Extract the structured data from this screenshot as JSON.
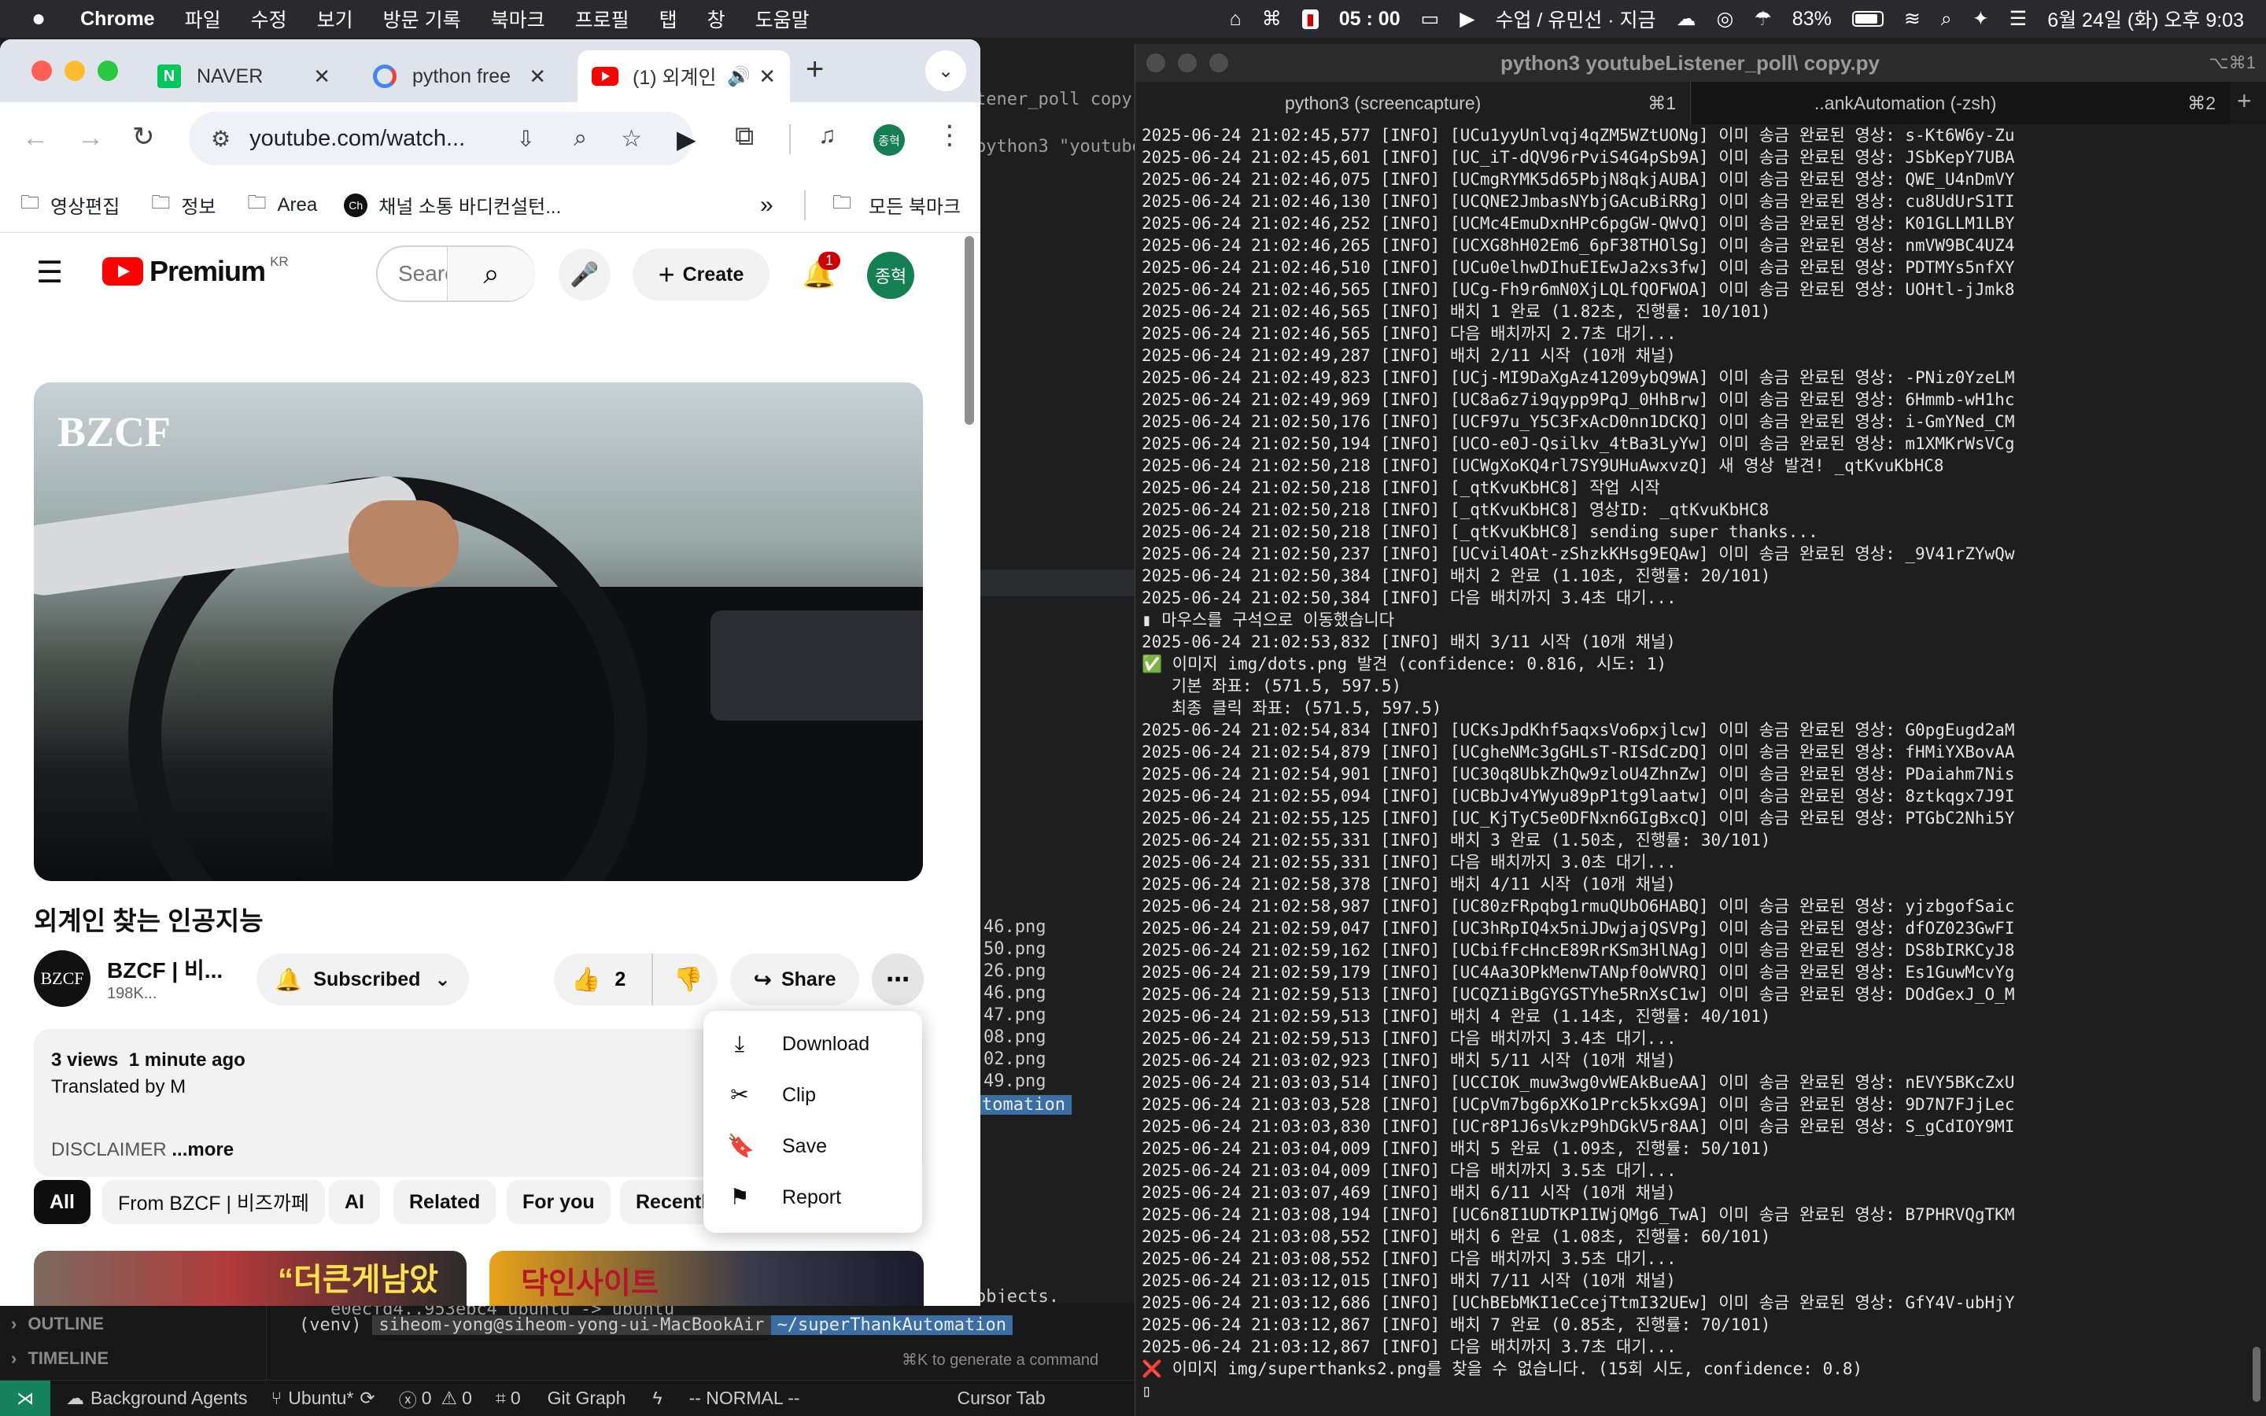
{
  "menubar": {
    "app": "Chrome",
    "items": [
      "파일",
      "수정",
      "보기",
      "방문 기록",
      "북마크",
      "프로필",
      "탭",
      "창",
      "도움말"
    ],
    "time": "05 : 00",
    "now_playing": "수업 / 유민선 · 지금",
    "battery": "83%",
    "datetime": "6월 24일 (화) 오후 9:03"
  },
  "chrome": {
    "tabs": [
      {
        "title": "NAVER",
        "icon": "naver-icon"
      },
      {
        "title": "python free",
        "icon": "google-icon"
      },
      {
        "title": "(1) 외계인",
        "icon": "youtube-icon"
      }
    ],
    "url": "youtube.com/watch...",
    "profile_initial": "종혁",
    "bookmarks": [
      "영상편집",
      "정보",
      "Area",
      "채널 소통 바디컨설턴..."
    ],
    "all_bookmarks": "모든 북마크",
    "chevron": "»"
  },
  "youtube": {
    "logo_text": "Premium",
    "region": "KR",
    "search_placeholder": "Search",
    "create_label": "Create",
    "notifications_count": "1",
    "avatar": "종혁",
    "video_watermark": "BZCF",
    "video_title": "외계인 찾는 인공지능",
    "channel_name": "BZCF | 비...",
    "channel_avatar": "BZCF",
    "subscribers": "198K...",
    "subscribed_label": "Subscribed",
    "likes": "2",
    "share_label": "Share",
    "views": "3 views",
    "published": "1 minute ago",
    "translated": "Translated by M",
    "disclaimer": "DISCLAIMER",
    "more": "...more",
    "chips": [
      "All",
      "From BZCF | 비즈까페",
      "AI",
      "Related",
      "For you",
      "Recently uploaded"
    ],
    "thumb1_text": "“더큰게남았다”",
    "thumb2_text": "닥인사이트"
  },
  "menu": {
    "items": [
      {
        "label": "Download",
        "icon": "download-icon"
      },
      {
        "label": "Clip",
        "icon": "scissors-icon"
      },
      {
        "label": "Save",
        "icon": "bookmark-icon"
      },
      {
        "label": "Report",
        "icon": "flag-icon"
      }
    ]
  },
  "editor": {
    "partial_tab": "tener_poll copy.p",
    "partial_cmd": "python3 \"youtube",
    "files": [
      "46.png",
      "50.png",
      "26.png",
      "46.png",
      "47.png",
      "08.png",
      "02.png",
      "49.png"
    ],
    "branch_text": "tomation",
    "objects_text": "objects.",
    "git_line": "e0ecfd4..953ebc4  ubuntu -> ubuntu",
    "venv_prompt": "(venv)",
    "user_host": "siheom-yong@siheom-yong-ui-MacBookAir",
    "path": "~/superThankAutomation",
    "outline": "OUTLINE",
    "timeline": "TIMELINE",
    "cmdk": "⌘K to generate a command"
  },
  "statusbar": {
    "agents": "Background Agents",
    "branch": "Ubuntu*",
    "errors": "0",
    "warnings": "0",
    "info": "0",
    "git_graph": "Git Graph",
    "mode": "-- NORMAL --",
    "cursor_tab": "Cursor Tab"
  },
  "terminal": {
    "title": "python3 youtubeListener_poll\\ copy.py",
    "shortcut_title": "⌥⌘1",
    "tabs": [
      {
        "label": "python3 (screencapture)",
        "shortcut": "⌘1"
      },
      {
        "label": "..ankAutomation (-zsh)",
        "shortcut": "⌘2"
      }
    ],
    "lines": [
      "2025-06-24 21:02:45,577 [INFO] [UCu1yyUnlvqj4qZM5WZtUONg] 이미 송금 완료된 영상: s-Kt6W6y-Zu",
      "2025-06-24 21:02:45,601 [INFO] [UC_iT-dQV96rPviS4G4pSb9A] 이미 송금 완료된 영상: JSbKepY7UBA",
      "2025-06-24 21:02:46,075 [INFO] [UCmgRYMK5d65PbjN8qkjAUBA] 이미 송금 완료된 영상: QWE_U4nDmVY",
      "2025-06-24 21:02:46,130 [INFO] [UCQNE2JmbasNYbjGAcuBiRRg] 이미 송금 완료된 영상: cu8UdUrS1TI",
      "2025-06-24 21:02:46,252 [INFO] [UCMc4EmuDxnHPc6pgGW-QWvQ] 이미 송금 완료된 영상: K01GLLM1LBY",
      "2025-06-24 21:02:46,265 [INFO] [UCXG8hH02Em6_6pF38THOlSg] 이미 송금 완료된 영상: nmVW9BC4UZ4",
      "2025-06-24 21:02:46,510 [INFO] [UCu0elhwDIhuEIEwJa2xs3fw] 이미 송금 완료된 영상: PDTMYs5nfXY",
      "2025-06-24 21:02:46,565 [INFO] [UCg-Fh9r6mN0XjLQLfQOFWOA] 이미 송금 완료된 영상: UOHtl-jJmk8",
      "2025-06-24 21:02:46,565 [INFO] 배치 1 완료 (1.82초, 진행률: 10/101)",
      "2025-06-24 21:02:46,565 [INFO] 다음 배치까지 2.7초 대기...",
      "2025-06-24 21:02:49,287 [INFO] 배치 2/11 시작 (10개 채널)",
      "2025-06-24 21:02:49,823 [INFO] [UCj-MI9DaXgAz41209ybQ9WA] 이미 송금 완료된 영상: -PNiz0YzeLM",
      "2025-06-24 21:02:49,969 [INFO] [UC8a6z7i9qypp9PqJ_0HhBrw] 이미 송금 완료된 영상: 6Hmmb-wH1hc",
      "2025-06-24 21:02:50,176 [INFO] [UCF97u_Y5C3FxAcD0nn1DCKQ] 이미 송금 완료된 영상: i-GmYNed_CM",
      "2025-06-24 21:02:50,194 [INFO] [UCO-e0J-Qsilkv_4tBa3LyYw] 이미 송금 완료된 영상: m1XMKrWsVCg",
      "2025-06-24 21:02:50,218 [INFO] [UCWgXoKQ4rl7SY9UHuAwxvzQ] 새 영상 발견! _qtKvuKbHC8",
      "2025-06-24 21:02:50,218 [INFO] [_qtKvuKbHC8] 작업 시작",
      "2025-06-24 21:02:50,218 [INFO] [_qtKvuKbHC8] 영상ID: _qtKvuKbHC8",
      "2025-06-24 21:02:50,218 [INFO] [_qtKvuKbHC8] sending super thanks...",
      "2025-06-24 21:02:50,237 [INFO] [UCvil4OAt-zShzkKHsg9EQAw] 이미 송금 완료된 영상: _9V41rZYwQw",
      "2025-06-24 21:02:50,384 [INFO] 배치 2 완료 (1.10초, 진행률: 20/101)",
      "2025-06-24 21:02:50,384 [INFO] 다음 배치까지 3.4초 대기...",
      "▮ 마우스를 구석으로 이동했습니다",
      "2025-06-24 21:02:53,832 [INFO] 배치 3/11 시작 (10개 채널)",
      "✅ 이미지 img/dots.png 발견 (confidence: 0.816, 시도: 1)",
      "   기본 좌표: (571.5, 597.5)",
      "   최종 클릭 좌표: (571.5, 597.5)",
      "2025-06-24 21:02:54,834 [INFO] [UCKsJpdKhf5aqxsVo6pxjlcw] 이미 송금 완료된 영상: G0pgEugd2aM",
      "2025-06-24 21:02:54,879 [INFO] [UCgheNMc3gGHLsT-RISdCzDQ] 이미 송금 완료된 영상: fHMiYXBovAA",
      "2025-06-24 21:02:54,901 [INFO] [UC30q8UbkZhQw9zloU4ZhnZw] 이미 송금 완료된 영상: PDaiahm7Nis",
      "2025-06-24 21:02:55,094 [INFO] [UCBbJv4YWyu89pP1tg9laatw] 이미 송금 완료된 영상: 8ztkqgx7J9I",
      "2025-06-24 21:02:55,125 [INFO] [UC_KjTyC5e0DFNxn6GIgBxcQ] 이미 송금 완료된 영상: PTGbC2Nhi5Y",
      "2025-06-24 21:02:55,331 [INFO] 배치 3 완료 (1.50초, 진행률: 30/101)",
      "2025-06-24 21:02:55,331 [INFO] 다음 배치까지 3.0초 대기...",
      "2025-06-24 21:02:58,378 [INFO] 배치 4/11 시작 (10개 채널)",
      "2025-06-24 21:02:58,987 [INFO] [UC80zFRpqbg1rmuQUbO6HABQ] 이미 송금 완료된 영상: yjzbgofSaic",
      "2025-06-24 21:02:59,047 [INFO] [UC3hRpIQ4x5niJDwjajQSVPg] 이미 송금 완료된 영상: dfOZ023GwFI",
      "2025-06-24 21:02:59,162 [INFO] [UCbifFcHncE89RrKSm3HlNAg] 이미 송금 완료된 영상: DS8bIRKCyJ8",
      "2025-06-24 21:02:59,179 [INFO] [UC4Aa3OPkMenwTANpf0oWVRQ] 이미 송금 완료된 영상: Es1GuwMcvYg",
      "2025-06-24 21:02:59,513 [INFO] [UCQZ1iBgGYGSTYhe5RnXsC1w] 이미 송금 완료된 영상: DOdGexJ_O_M",
      "2025-06-24 21:02:59,513 [INFO] 배치 4 완료 (1.14초, 진행률: 40/101)",
      "2025-06-24 21:02:59,513 [INFO] 다음 배치까지 3.4초 대기...",
      "2025-06-24 21:03:02,923 [INFO] 배치 5/11 시작 (10개 채널)",
      "2025-06-24 21:03:03,514 [INFO] [UCCIOK_muw3wg0vWEAkBueAA] 이미 송금 완료된 영상: nEVY5BKcZxU",
      "2025-06-24 21:03:03,528 [INFO] [UCpVm7bg6pXKo1Prck5kxG9A] 이미 송금 완료된 영상: 9D7N7FJjLec",
      "2025-06-24 21:03:03,830 [INFO] [UCr8P1J6sVkzP9hDGkV5r8AA] 이미 송금 완료된 영상: S_gCdIOY9MI",
      "2025-06-24 21:03:04,009 [INFO] 배치 5 완료 (1.09초, 진행률: 50/101)",
      "2025-06-24 21:03:04,009 [INFO] 다음 배치까지 3.5초 대기...",
      "2025-06-24 21:03:07,469 [INFO] 배치 6/11 시작 (10개 채널)",
      "2025-06-24 21:03:08,194 [INFO] [UC6n8I1UDTKP1IWjQMg6_TwA] 이미 송금 완료된 영상: B7PHRVQgTKM",
      "2025-06-24 21:03:08,552 [INFO] 배치 6 완료 (1.08초, 진행률: 60/101)",
      "2025-06-24 21:03:08,552 [INFO] 다음 배치까지 3.5초 대기...",
      "2025-06-24 21:03:12,015 [INFO] 배치 7/11 시작 (10개 채널)",
      "2025-06-24 21:03:12,686 [INFO] [UChBEbMKI1eCcejTtmI32UEw] 이미 송금 완료된 영상: GfY4V-ubHjY",
      "2025-06-24 21:03:12,867 [INFO] 배치 7 완료 (0.85초, 진행률: 70/101)",
      "2025-06-24 21:03:12,867 [INFO] 다음 배치까지 3.7초 대기...",
      "❌ 이미지 img/superthanks2.png를 찾을 수 없습니다. (15회 시도, confidence: 0.8)",
      "▯"
    ]
  }
}
